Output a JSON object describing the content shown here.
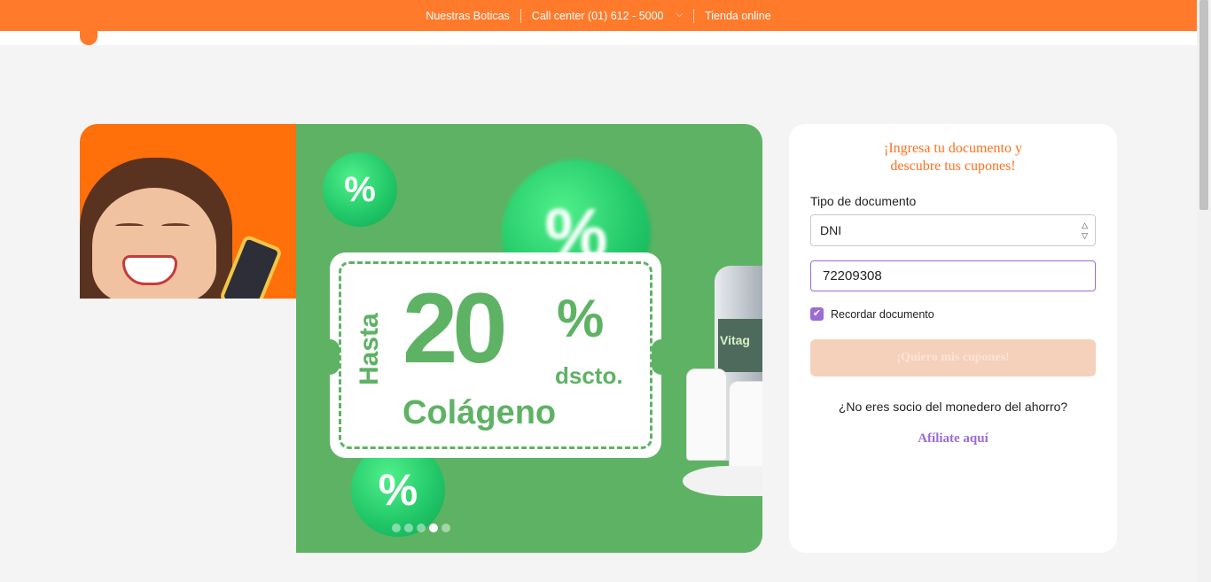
{
  "topbar": {
    "stores_link": "Nuestras Boticas",
    "call_center": "Call center (01) 612 - 5000",
    "online_store_link": "Tienda online",
    "color": "#ff7a2b"
  },
  "banner": {
    "coupon_upto": "Hasta",
    "coupon_value": "20",
    "coupon_percent": "%",
    "coupon_discount": "dscto.",
    "coupon_product": "Colágeno",
    "percent_glyph": "%",
    "product_label": "Vitag",
    "carousel": {
      "total": 5,
      "active_index": 3
    },
    "bg_color": "#5eb264"
  },
  "form": {
    "title": "¡Ingresa tu documento y descubre tus cupones!",
    "doc_type_label": "Tipo de documento",
    "doc_type_value": "DNI",
    "doc_number_value": "72209308",
    "remember_label": "Recordar documento",
    "remember_checked": true,
    "submit_label": "¡Quiero mis cupones!",
    "not_member_text": "¿No eres socio del monedero del ahorro?",
    "affiliate_link": "Afíliate aquí",
    "accent_color": "#9a6cd6"
  }
}
